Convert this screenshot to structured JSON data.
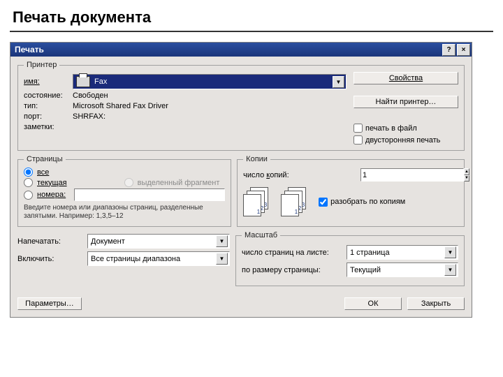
{
  "slide": {
    "title": "Печать документа"
  },
  "dialog": {
    "title": "Печать"
  },
  "buttons": {
    "help": "?",
    "close": "×",
    "properties": "Свойства",
    "find_printer": "Найти принтер…",
    "options": "Параметры…",
    "ok": "ОК",
    "cancel": "Закрыть"
  },
  "printer": {
    "legend": "Принтер",
    "name_label": "имя:",
    "name_value": "Fax",
    "state_label": "состояние:",
    "state_value": "Свободен",
    "type_label": "тип:",
    "type_value": "Microsoft Shared Fax Driver",
    "port_label": "порт:",
    "port_value": "SHRFAX:",
    "notes_label": "заметки:",
    "print_to_file": "печать в файл",
    "duplex": "двусторонняя печать"
  },
  "pages": {
    "legend": "Страницы",
    "all": "все",
    "current": "текущая",
    "selection": "выделенный фрагмент",
    "numbers": "номера:",
    "hint": "Введите номера или диапазоны страниц, разделенные запятыми. Например: 1,3,5–12"
  },
  "copies": {
    "legend": "Копии",
    "count_label": "число копий:",
    "count_value": "1",
    "collate": "разобрать по копиям",
    "p1": "1",
    "p2": "2",
    "p3": "3"
  },
  "scale": {
    "legend": "Масштаб",
    "pages_per_sheet_label": "число страниц на листе:",
    "pages_per_sheet_value": "1 страница",
    "fit_label": "по размеру страницы:",
    "fit_value": "Текущий"
  },
  "what": {
    "print_label": "Напечатать:",
    "print_value": "Документ",
    "include_label": "Включить:",
    "include_value": "Все страницы диапазона"
  }
}
